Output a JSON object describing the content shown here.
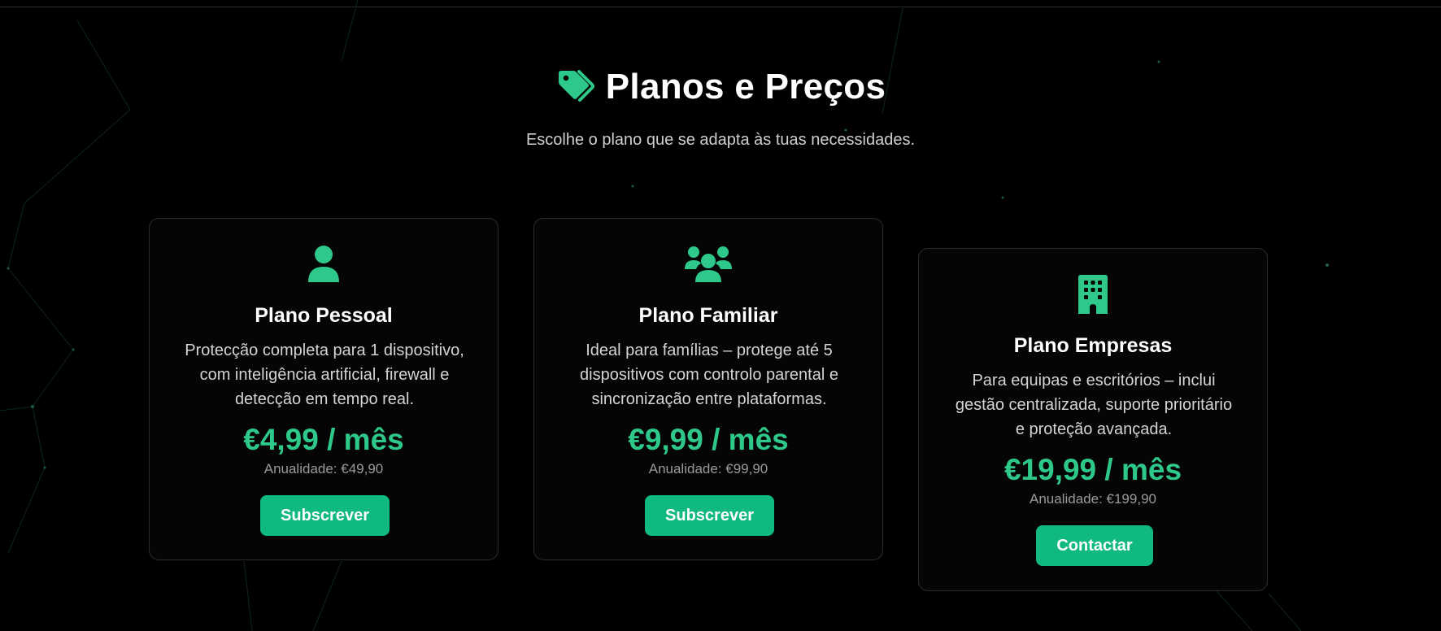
{
  "colors": {
    "background": "#000000",
    "accent": "#2ec98a",
    "button": "#10b981",
    "card_border": "#2b2b2b"
  },
  "header": {
    "icon": "tags-icon",
    "title": "Planos e Preços",
    "subtitle": "Escolhe o plano que se adapta às tuas necessidades."
  },
  "plans": [
    {
      "icon": "user-icon",
      "name": "Plano Pessoal",
      "description": "Protecção completa para 1 dispositivo, com inteligência artificial, firewall e detecção em tempo real.",
      "price": "€4,99 / mês",
      "annual": "Anualidade: €49,90",
      "cta": "Subscrever"
    },
    {
      "icon": "users-icon",
      "name": "Plano Familiar",
      "description": "Ideal para famílias – protege até 5 dispositivos com controlo parental e sincronização entre plataformas.",
      "price": "€9,99 / mês",
      "annual": "Anualidade: €99,90",
      "cta": "Subscrever"
    },
    {
      "icon": "building-icon",
      "name": "Plano Empresas",
      "description": "Para equipas e escritórios – inclui gestão centralizada, suporte prioritário e proteção avançada.",
      "price": "€19,99 / mês",
      "annual": "Anualidade: €199,90",
      "cta": "Contactar"
    }
  ]
}
